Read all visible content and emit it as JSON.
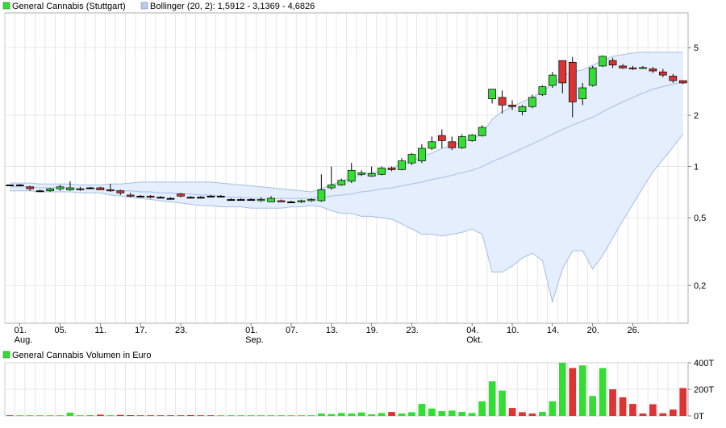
{
  "legend": {
    "price_label": "General Cannabis (Stuttgart)",
    "bollinger_label": "Bollinger (20, 2): 1,5912 - 3,1369 - 4,6826",
    "volume_label": "General Cannabis Volumen in Euro"
  },
  "colors": {
    "up": "#33dd33",
    "down": "#dd3333",
    "grid": "#dddddd",
    "band_fill": "#e4eefc",
    "band_line": "#a6bfe6",
    "frame": "#999999"
  },
  "chart_data": [
    {
      "type": "candlestick",
      "title": "",
      "y_scale": "log",
      "ylim": [
        0.12,
        8
      ],
      "yticks": [
        {
          "v": 5,
          "label": "5"
        },
        {
          "v": 2,
          "label": "2"
        },
        {
          "v": 1,
          "label": "1"
        },
        {
          "v": 0.5,
          "label": "0,5"
        },
        {
          "v": 0.2,
          "label": "0,2"
        }
      ],
      "xticks": [
        {
          "i": 1,
          "label": "01.",
          "sub": "Aug."
        },
        {
          "i": 5,
          "label": "05."
        },
        {
          "i": 9,
          "label": "11."
        },
        {
          "i": 13,
          "label": "17."
        },
        {
          "i": 17,
          "label": "23."
        },
        {
          "i": 24,
          "label": "01.",
          "sub": "Sep."
        },
        {
          "i": 28,
          "label": "07."
        },
        {
          "i": 32,
          "label": "13."
        },
        {
          "i": 36,
          "label": "19."
        },
        {
          "i": 40,
          "label": "23."
        },
        {
          "i": 46,
          "label": "04.",
          "sub": "Okt."
        },
        {
          "i": 50,
          "label": "10."
        },
        {
          "i": 54,
          "label": "14."
        },
        {
          "i": 58,
          "label": "20."
        },
        {
          "i": 62,
          "label": "26."
        }
      ],
      "candles": [
        [
          0.78,
          0.78,
          0.78,
          0.78
        ],
        [
          0.78,
          0.79,
          0.77,
          0.78
        ],
        [
          0.76,
          0.77,
          0.72,
          0.74
        ],
        [
          0.72,
          0.73,
          0.71,
          0.72
        ],
        [
          0.72,
          0.75,
          0.71,
          0.74
        ],
        [
          0.74,
          0.78,
          0.72,
          0.76
        ],
        [
          0.73,
          0.82,
          0.72,
          0.75
        ],
        [
          0.74,
          0.76,
          0.72,
          0.73
        ],
        [
          0.75,
          0.76,
          0.74,
          0.75
        ],
        [
          0.75,
          0.76,
          0.73,
          0.73
        ],
        [
          0.73,
          0.79,
          0.71,
          0.72
        ],
        [
          0.72,
          0.73,
          0.68,
          0.7
        ],
        [
          0.68,
          0.7,
          0.66,
          0.67
        ],
        [
          0.67,
          0.68,
          0.66,
          0.67
        ],
        [
          0.67,
          0.68,
          0.65,
          0.66
        ],
        [
          0.66,
          0.67,
          0.65,
          0.66
        ],
        [
          0.65,
          0.66,
          0.64,
          0.65
        ],
        [
          0.69,
          0.7,
          0.66,
          0.67
        ],
        [
          0.66,
          0.67,
          0.65,
          0.66
        ],
        [
          0.66,
          0.67,
          0.65,
          0.66
        ],
        [
          0.67,
          0.68,
          0.66,
          0.67
        ],
        [
          0.67,
          0.68,
          0.67,
          0.67
        ],
        [
          0.64,
          0.65,
          0.63,
          0.64
        ],
        [
          0.64,
          0.65,
          0.63,
          0.64
        ],
        [
          0.64,
          0.65,
          0.63,
          0.64
        ],
        [
          0.63,
          0.66,
          0.62,
          0.64
        ],
        [
          0.62,
          0.67,
          0.62,
          0.65
        ],
        [
          0.63,
          0.64,
          0.62,
          0.62
        ],
        [
          0.62,
          0.63,
          0.61,
          0.62
        ],
        [
          0.62,
          0.64,
          0.61,
          0.63
        ],
        [
          0.63,
          0.65,
          0.62,
          0.64
        ],
        [
          0.63,
          0.9,
          0.62,
          0.73
        ],
        [
          0.75,
          1.0,
          0.73,
          0.78
        ],
        [
          0.78,
          0.85,
          0.77,
          0.83
        ],
        [
          0.82,
          1.05,
          0.8,
          0.95
        ],
        [
          0.9,
          0.95,
          0.88,
          0.92
        ],
        [
          0.88,
          1.0,
          0.87,
          0.91
        ],
        [
          0.9,
          1.0,
          0.89,
          0.98
        ],
        [
          0.98,
          1.0,
          0.94,
          0.96
        ],
        [
          0.96,
          1.12,
          0.95,
          1.08
        ],
        [
          1.05,
          1.2,
          1.02,
          1.18
        ],
        [
          1.08,
          1.35,
          1.05,
          1.28
        ],
        [
          1.28,
          1.5,
          1.25,
          1.4
        ],
        [
          1.52,
          1.65,
          1.28,
          1.42
        ],
        [
          1.4,
          1.5,
          1.25,
          1.29
        ],
        [
          1.29,
          1.55,
          1.27,
          1.5
        ],
        [
          1.42,
          1.55,
          1.4,
          1.53
        ],
        [
          1.52,
          1.75,
          1.5,
          1.7
        ],
        [
          2.5,
          2.8,
          2.35,
          2.85
        ],
        [
          2.55,
          2.8,
          2.05,
          2.3
        ],
        [
          2.3,
          2.45,
          2.15,
          2.25
        ],
        [
          2.1,
          2.3,
          2.0,
          2.25
        ],
        [
          2.25,
          2.65,
          2.2,
          2.55
        ],
        [
          2.65,
          3.0,
          2.6,
          2.95
        ],
        [
          3.0,
          3.6,
          2.9,
          3.45
        ],
        [
          4.2,
          4.2,
          2.7,
          3.1
        ],
        [
          4.1,
          4.4,
          1.95,
          2.4
        ],
        [
          2.5,
          3.1,
          2.3,
          2.9
        ],
        [
          3.0,
          3.9,
          2.95,
          3.8
        ],
        [
          3.9,
          4.5,
          3.85,
          4.45
        ],
        [
          4.2,
          4.35,
          3.8,
          3.95
        ],
        [
          3.9,
          4.0,
          3.75,
          3.8
        ],
        [
          3.8,
          3.9,
          3.7,
          3.78
        ],
        [
          3.8,
          3.9,
          3.75,
          3.82
        ],
        [
          3.75,
          3.85,
          3.55,
          3.65
        ],
        [
          3.6,
          3.75,
          3.35,
          3.45
        ],
        [
          3.4,
          3.5,
          3.1,
          3.2
        ],
        [
          3.2,
          3.2,
          3.05,
          3.1
        ]
      ],
      "bollinger": {
        "upper": [
          0.8,
          0.8,
          0.8,
          0.79,
          0.79,
          0.79,
          0.79,
          0.78,
          0.78,
          0.78,
          0.79,
          0.79,
          0.8,
          0.81,
          0.81,
          0.81,
          0.81,
          0.81,
          0.81,
          0.81,
          0.81,
          0.8,
          0.79,
          0.78,
          0.77,
          0.76,
          0.75,
          0.74,
          0.73,
          0.72,
          0.71,
          0.74,
          0.78,
          0.82,
          0.86,
          0.9,
          0.92,
          0.94,
          0.98,
          1.03,
          1.08,
          1.14,
          1.2,
          1.28,
          1.33,
          1.4,
          1.46,
          1.55,
          1.9,
          2.1,
          2.25,
          2.4,
          2.55,
          2.75,
          3.05,
          3.4,
          3.6,
          3.7,
          3.95,
          4.2,
          4.45,
          4.55,
          4.65,
          4.7,
          4.7,
          4.7,
          4.7,
          4.68
        ],
        "middle": [
          0.76,
          0.76,
          0.76,
          0.75,
          0.75,
          0.75,
          0.75,
          0.74,
          0.74,
          0.74,
          0.73,
          0.72,
          0.72,
          0.71,
          0.71,
          0.7,
          0.7,
          0.69,
          0.69,
          0.68,
          0.68,
          0.67,
          0.66,
          0.66,
          0.65,
          0.65,
          0.65,
          0.65,
          0.65,
          0.65,
          0.65,
          0.66,
          0.67,
          0.68,
          0.69,
          0.71,
          0.72,
          0.74,
          0.75,
          0.77,
          0.79,
          0.81,
          0.84,
          0.86,
          0.89,
          0.92,
          0.95,
          1.0,
          1.07,
          1.13,
          1.2,
          1.28,
          1.36,
          1.45,
          1.55,
          1.65,
          1.75,
          1.85,
          1.95,
          2.1,
          2.25,
          2.4,
          2.55,
          2.7,
          2.85,
          2.95,
          3.05,
          3.14
        ],
        "lower": [
          0.72,
          0.72,
          0.72,
          0.71,
          0.71,
          0.71,
          0.71,
          0.7,
          0.7,
          0.7,
          0.68,
          0.67,
          0.66,
          0.65,
          0.64,
          0.63,
          0.62,
          0.61,
          0.6,
          0.59,
          0.59,
          0.58,
          0.58,
          0.58,
          0.57,
          0.57,
          0.57,
          0.57,
          0.58,
          0.58,
          0.59,
          0.58,
          0.55,
          0.53,
          0.53,
          0.51,
          0.51,
          0.5,
          0.49,
          0.46,
          0.43,
          0.4,
          0.4,
          0.39,
          0.4,
          0.41,
          0.43,
          0.4,
          0.24,
          0.24,
          0.26,
          0.29,
          0.31,
          0.28,
          0.16,
          0.25,
          0.32,
          0.32,
          0.25,
          0.3,
          0.38,
          0.48,
          0.6,
          0.75,
          0.93,
          1.1,
          1.3,
          1.55
        ]
      }
    },
    {
      "type": "bar",
      "title": "",
      "ylim": [
        0,
        400
      ],
      "yticks": [
        {
          "v": 400,
          "label": "400T"
        },
        {
          "v": 200,
          "label": "200T"
        },
        {
          "v": 0,
          "label": "0T"
        }
      ],
      "values": [
        0,
        0,
        2,
        0,
        5,
        2,
        25,
        4,
        6,
        10,
        3,
        8,
        6,
        2,
        0,
        5,
        2,
        0,
        6,
        0,
        0,
        0,
        0,
        0,
        0,
        0,
        0,
        0,
        0,
        3,
        4,
        18,
        14,
        22,
        18,
        26,
        12,
        22,
        30,
        18,
        28,
        90,
        56,
        36,
        40,
        30,
        22,
        110,
        260,
        190,
        60,
        28,
        18,
        30,
        110,
        410,
        360,
        380,
        150,
        360,
        200,
        140,
        90,
        18,
        88,
        20,
        48,
        210
      ],
      "directions": [
        "d",
        "u",
        "u",
        "u",
        "u",
        "u",
        "u",
        "u",
        "u",
        "d",
        "u",
        "d",
        "d",
        "d",
        "d",
        "d",
        "d",
        "d",
        "d",
        "d",
        "d",
        "u",
        "u",
        "u",
        "u",
        "u",
        "u",
        "u",
        "u",
        "u",
        "u",
        "u",
        "u",
        "u",
        "u",
        "u",
        "u",
        "u",
        "d",
        "u",
        "u",
        "u",
        "u",
        "u",
        "u",
        "u",
        "u",
        "u",
        "u",
        "u",
        "d",
        "d",
        "d",
        "u",
        "u",
        "u",
        "d",
        "u",
        "u",
        "u",
        "d",
        "d",
        "d",
        "d",
        "d",
        "d",
        "d",
        "d"
      ]
    }
  ]
}
